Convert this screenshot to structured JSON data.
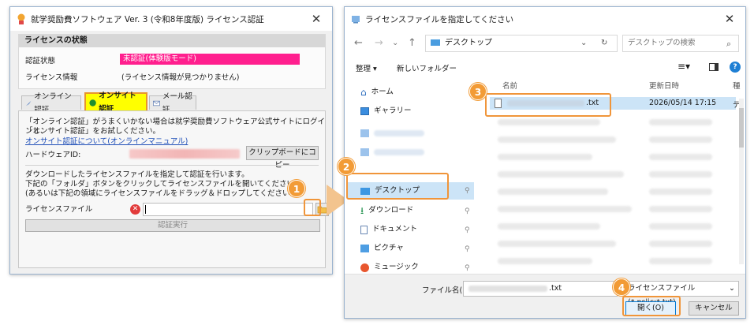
{
  "left_dialog": {
    "title": "就学奨励費ソフトウェア Ver. 3 (令和8年度版) ライセンス認証",
    "close": "✕",
    "section_title": "ライセンスの状態",
    "status_label": "認証状態",
    "status_value": "未認証(体験版モード)",
    "info_label": "ライセンス情報",
    "info_value": "(ライセンス情報が見つかりません)",
    "tabs": [
      "オンライン認証",
      "オンサイト認証",
      "メール認証"
    ],
    "desc1": "「オンライン認証」がうまくいかない場合は就学奨励費ソフトウェア公式サイトにログインし、",
    "desc2": "「オンサイト認証」をお試しください。",
    "manual_link": "オンサイト認証について(オンラインマニュアル)",
    "hw_label": "ハードウェアID:",
    "copy_button": "クリップボードにコピー",
    "inst1": "ダウンロードしたライセンスファイルを指定して認証を行います。",
    "inst2": "下記の「フォルダ」ボタンをクリックしてライセンスファイルを開いてください。",
    "inst3": "(あるいは下記の領域にライセンスファイルをドラッグ＆ドロップしてください。)",
    "lf_label": "ライセンスファイル",
    "run_button": "認証実行"
  },
  "right_dialog": {
    "title": "ライセンスファイルを指定してください",
    "close": "✕",
    "breadcrumb": "デスクトップ",
    "search_placeholder": "デスクトップの検索",
    "organize": "整理 ▾",
    "new_folder": "新しいフォルダー",
    "sidebar": [
      {
        "label": "ホーム",
        "icon": "home-icon"
      },
      {
        "label": "ギャラリー",
        "icon": "gallery-icon"
      },
      {
        "label": "デスクトップ",
        "icon": "desktop-icon"
      },
      {
        "label": "ダウンロード",
        "icon": "download-icon"
      },
      {
        "label": "ドキュメント",
        "icon": "document-icon"
      },
      {
        "label": "ピクチャ",
        "icon": "pictures-icon"
      },
      {
        "label": "ミュージック",
        "icon": "music-icon"
      }
    ],
    "col_name": "名前",
    "col_date": "更新日時",
    "col_type": "種",
    "selected_file": {
      "name_suffix": ".txt",
      "date": "2026/05/14 17:15",
      "type": "テ"
    },
    "filename_label": "ファイル名(N):",
    "filename_suffix": ".txt",
    "filter": "ライセンスファイル(*.pslic;*.txt)",
    "open_button": "開く(O)",
    "cancel_button": "キャンセル"
  },
  "badges": [
    "1",
    "2",
    "3",
    "4"
  ],
  "colors": {
    "accent": "#f29b36",
    "status_bg": "#ff1f8e",
    "tab_active": "#ffff00",
    "link": "#1f4fb8"
  }
}
